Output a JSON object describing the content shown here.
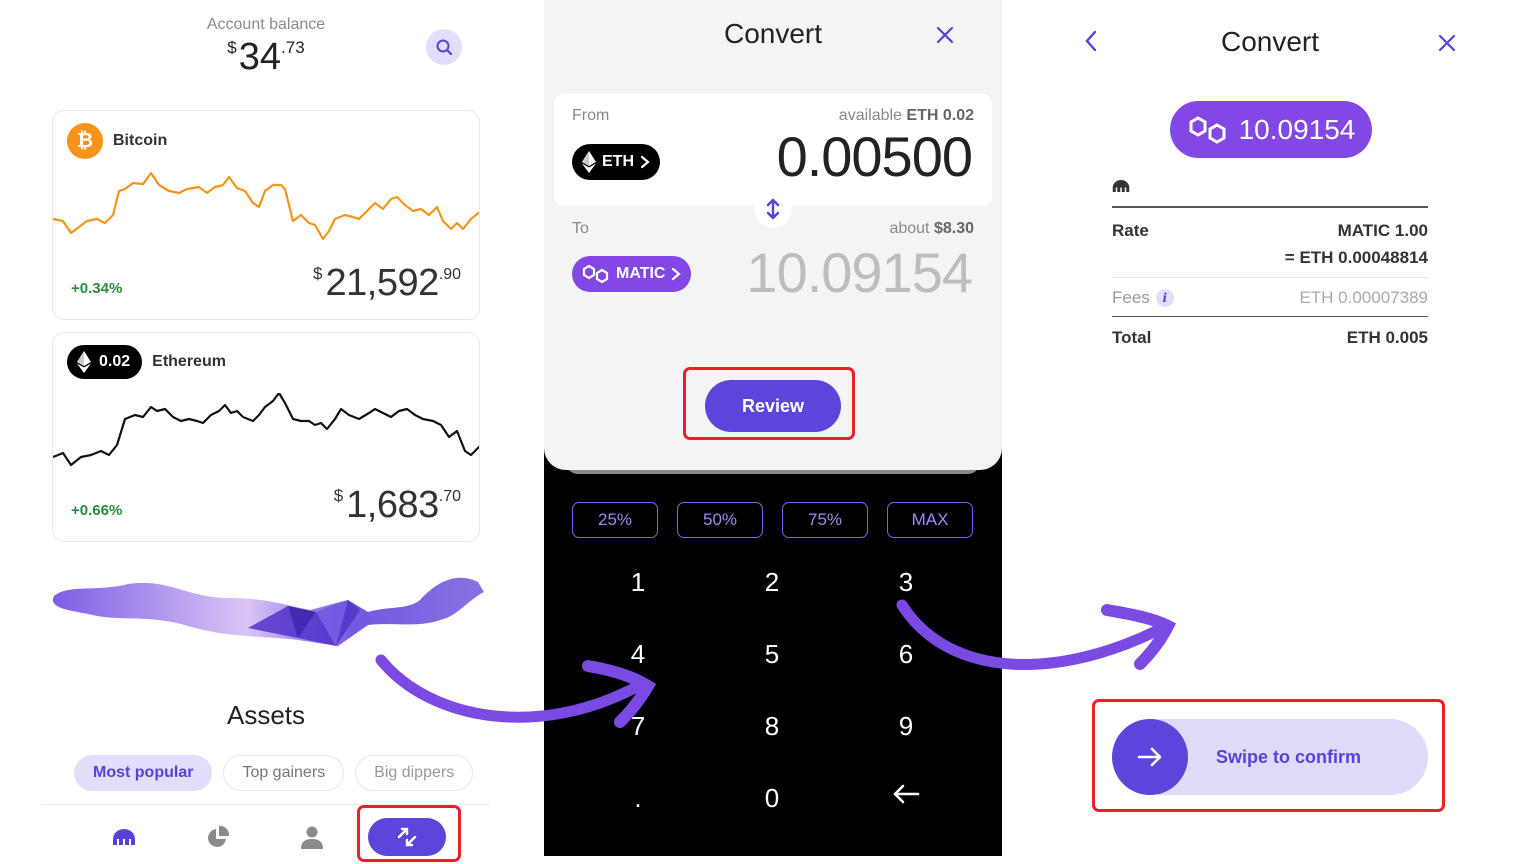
{
  "left": {
    "balance_label": "Account balance",
    "balance": {
      "currency": "$",
      "integer": "34",
      "decimal": ".73"
    },
    "search_icon": "search-icon",
    "assets": [
      {
        "name": "Bitcoin",
        "icon": "bitcoin-icon",
        "icon_glyph": "₿",
        "change": "+0.34%",
        "price": {
          "currency": "$",
          "integer": "21,592",
          "decimal": ".90"
        },
        "line_color": "#f7931a"
      },
      {
        "name": "Ethereum",
        "icon": "ethereum-icon",
        "holding": "0.02",
        "change": "+0.66%",
        "price": {
          "currency": "$",
          "integer": "1,683",
          "decimal": ".70"
        },
        "line_color": "#111111"
      }
    ],
    "assets_title": "Assets",
    "chips": [
      {
        "label": "Most popular",
        "active": true
      },
      {
        "label": "Top gainers",
        "active": false
      },
      {
        "label": "Big dippers",
        "active": false
      }
    ],
    "bottom_nav": [
      {
        "name": "home",
        "icon": "kraken-logo-icon"
      },
      {
        "name": "portfolio",
        "icon": "pie-chart-icon"
      },
      {
        "name": "account",
        "icon": "user-icon"
      },
      {
        "name": "convert",
        "icon": "convert-arrows-icon",
        "active": true
      }
    ]
  },
  "convert": {
    "title": "Convert",
    "close_icon": "close-icon",
    "from_label": "From",
    "available_prefix": "available",
    "available_value": "ETH 0.02",
    "from_token": "ETH",
    "from_amount": "0.00500",
    "to_label": "To",
    "about_prefix": "about",
    "about_value": "$8.30",
    "to_token": "MATIC",
    "to_amount": "10.09154",
    "review_label": "Review",
    "quick_amounts": [
      "25%",
      "50%",
      "75%",
      "MAX"
    ],
    "keys": [
      "1",
      "2",
      "3",
      "4",
      "5",
      "6",
      "7",
      "8",
      "9",
      ".",
      "0",
      "←"
    ]
  },
  "confirm": {
    "title": "Convert",
    "back_icon": "chevron-left-icon",
    "close_icon": "close-icon",
    "amount": "10.09154",
    "rate_label": "Rate",
    "rate_line1": "MATIC 1.00",
    "rate_line2": "= ETH 0.00048814",
    "fees_label": "Fees",
    "fees_value": "ETH 0.00007389",
    "total_label": "Total",
    "total_value": "ETH 0.005",
    "swipe_label": "Swipe to confirm"
  },
  "colors": {
    "accent": "#5b45db",
    "matic": "#8247e5",
    "highlight_box": "#e8202a",
    "annotation_arrow": "#7b4ae2",
    "positive": "#2a8a3e"
  }
}
